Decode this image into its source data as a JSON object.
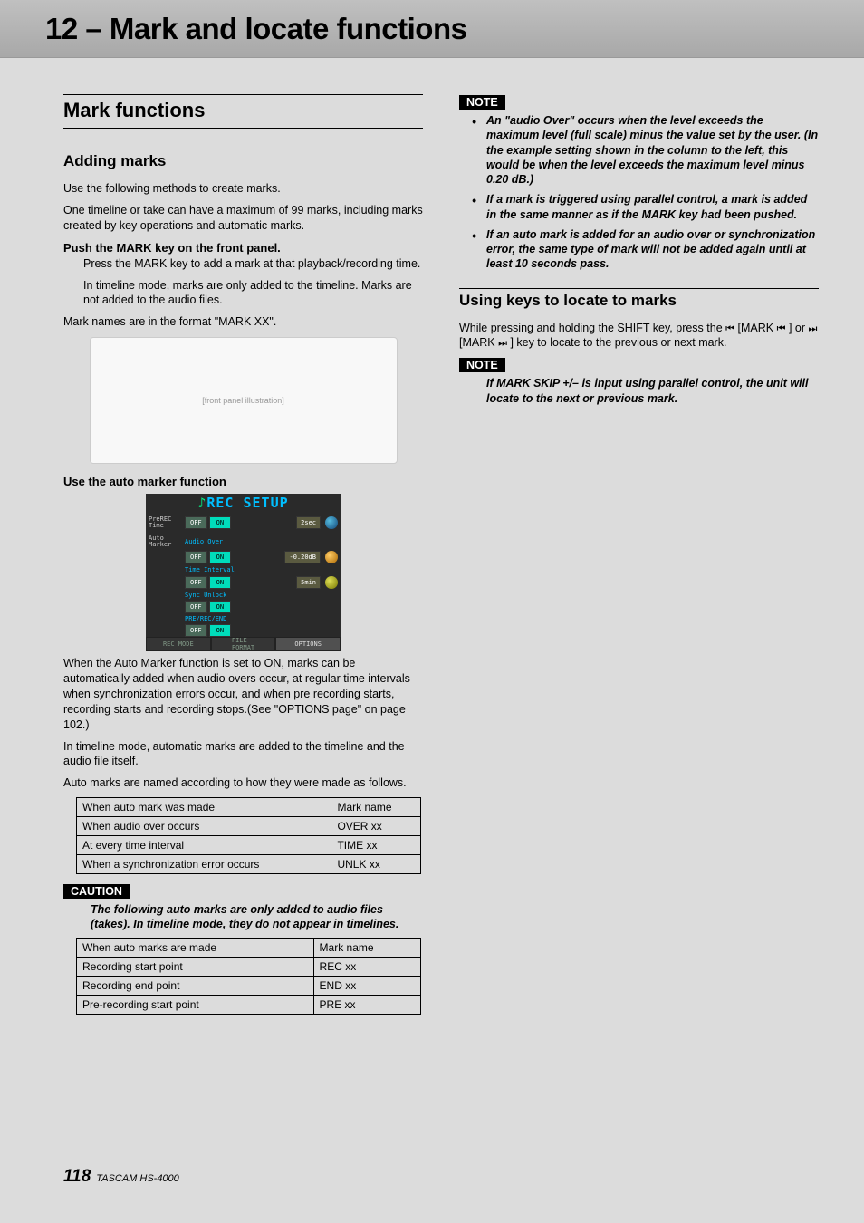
{
  "header": {
    "chapter_title": "12 – Mark and locate functions"
  },
  "left_col": {
    "section_title": "Mark functions",
    "sub1_title": "Adding marks",
    "p1": "Use the following methods to create marks.",
    "p2": "One timeline or take can have a maximum of 99 marks, including marks created by key operations and automatic marks.",
    "bh1": "Push the MARK key on the front panel.",
    "p3": "Press the MARK key to add a mark at that playback/recording time.",
    "p4": "In timeline mode, marks are only added to the timeline. Marks are not added to the audio files.",
    "p5": "Mark names are in the format \"MARK XX\".",
    "bh2": "Use the auto marker function",
    "rec_setup": {
      "title": "REC SETUP",
      "rows": {
        "r1_label": "PreREC\nTime",
        "r1_off": "OFF",
        "r1_on": "ON",
        "r1_val": "2sec",
        "r2_label": "Auto\nMarker",
        "r2_sub": "Audio Over",
        "r2_off": "OFF",
        "r2_on": "ON",
        "r2_val": "-0.20dB",
        "r3_sub": "Time Interval",
        "r3_off": "OFF",
        "r3_on": "ON",
        "r3_val": "5min",
        "r4_sub": "Sync Unlock",
        "r4_off": "OFF",
        "r4_on": "ON",
        "r5_sub": "PRE/REC/END",
        "r5_off": "OFF",
        "r5_on": "ON"
      },
      "tabs": {
        "t1": "REC MODE",
        "t2": "FILE\nFORMAT",
        "t3": "OPTIONS"
      }
    },
    "p6": "When the Auto Marker function is set to ON, marks can be automatically added when audio overs occur, at regular time intervals when synchronization errors occur, and when pre recording starts, recording starts and recording stops.(See \"OPTIONS page\" on page 102.)",
    "p7": "In timeline mode, automatic marks are added to the timeline and the audio file itself.",
    "p8": "Auto marks are named according to how they were made as follows.",
    "table1": {
      "h1": "When auto mark was made",
      "h2": "Mark name",
      "r1c1": "When audio over occurs",
      "r1c2": "OVER xx",
      "r2c1": "At every time interval",
      "r2c2": "TIME xx",
      "r3c1": "When a synchronization error occurs",
      "r3c2": "UNLK xx"
    },
    "caution_label": "CAUTION",
    "caution_text": "The following auto marks are only added to audio files (takes). In timeline mode, they do not appear in timelines.",
    "table2": {
      "h1": "When auto marks are made",
      "h2": "Mark name",
      "r1c1": "Recording start point",
      "r1c2": "REC xx",
      "r2c1": "Recording end point",
      "r2c2": "END xx",
      "r3c1": "Pre-recording start point",
      "r3c2": "PRE xx"
    }
  },
  "right_col": {
    "note_label": "NOTE",
    "note_items": {
      "n1": "An \"audio Over\" occurs when the level exceeds the maximum level (full scale) minus the value set by the user. (In the example setting shown in the column to the left, this would be when the level exceeds the maximum level minus 0.20 dB.)",
      "n2": "If a mark is triggered using parallel control, a mark is added in the same manner as if the MARK key had been pushed.",
      "n3": "If an auto mark is added for an audio over or synchronization error, the same type of mark will not be added again until at least 10 seconds pass."
    },
    "sub2_title": "Using keys to locate to marks",
    "p1_a": "While pressing and holding the SHIFT key, press the ",
    "p1_b": " [MARK ",
    "p1_c": " ] or ",
    "p1_d": " [MARK ",
    "p1_e": " ] key to locate to the previous or next mark.",
    "note2_label": "NOTE",
    "note2_text": "If MARK SKIP +/– is input using parallel control, the unit will locate to the next or previous mark."
  },
  "footer": {
    "page": "118",
    "model": "TASCAM  HS-4000"
  }
}
